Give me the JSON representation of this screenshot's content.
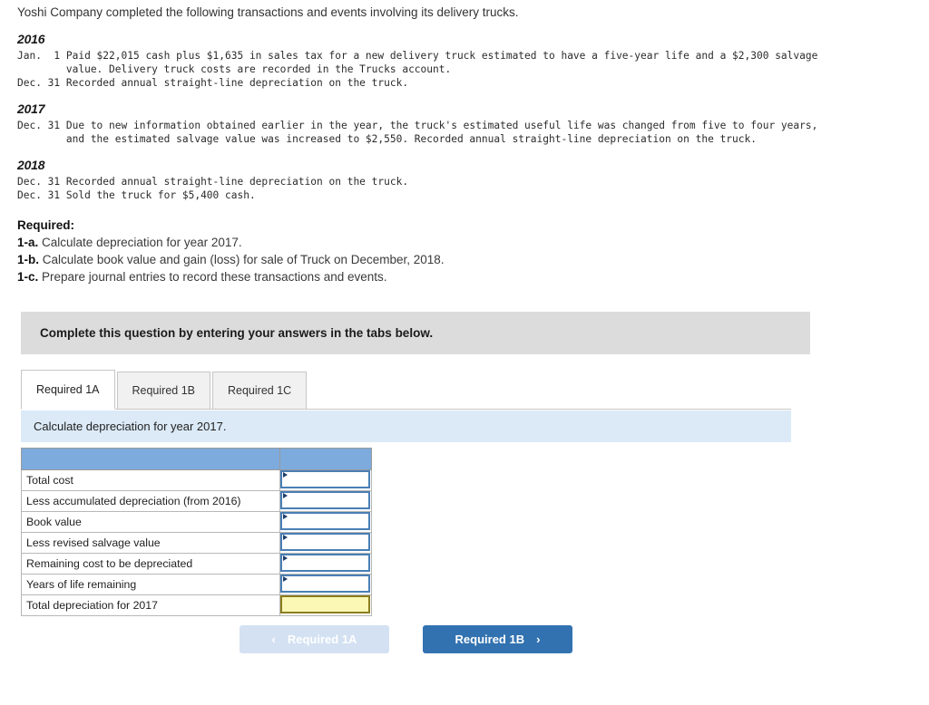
{
  "intro": "Yoshi Company completed the following transactions and events involving its delivery trucks.",
  "years": [
    {
      "label": "2016",
      "entries": "Jan.  1 Paid $22,015 cash plus $1,635 in sales tax for a new delivery truck estimated to have a five-year life and a $2,300 salvage\n        value. Delivery truck costs are recorded in the Trucks account.\nDec. 31 Recorded annual straight-line depreciation on the truck."
    },
    {
      "label": "2017",
      "entries": "Dec. 31 Due to new information obtained earlier in the year, the truck's estimated useful life was changed from five to four years,\n        and the estimated salvage value was increased to $2,550. Recorded annual straight-line depreciation on the truck."
    },
    {
      "label": "2018",
      "entries": "Dec. 31 Recorded annual straight-line depreciation on the truck.\nDec. 31 Sold the truck for $5,400 cash."
    }
  ],
  "required": {
    "heading": "Required:",
    "items": [
      {
        "marker": "1-a.",
        "text": "Calculate depreciation for year 2017."
      },
      {
        "marker": "1-b.",
        "text": "Calculate book value and gain (loss) for sale of Truck on December, 2018."
      },
      {
        "marker": "1-c.",
        "text": "Prepare journal entries to record these transactions and events."
      }
    ]
  },
  "callout": "Complete this question by entering your answers in the tabs below.",
  "tabs": [
    {
      "label": "Required 1A",
      "active": true
    },
    {
      "label": "Required 1B",
      "active": false
    },
    {
      "label": "Required 1C",
      "active": false
    }
  ],
  "sub_instruction": "Calculate depreciation for year 2017.",
  "table": {
    "header": [
      "",
      ""
    ],
    "rows": [
      {
        "label": "Total cost",
        "value": "",
        "type": "input"
      },
      {
        "label": "Less accumulated depreciation (from 2016)",
        "value": "",
        "type": "input"
      },
      {
        "label": "Book value",
        "value": "",
        "type": "input"
      },
      {
        "label": "Less revised salvage value",
        "value": "",
        "type": "input"
      },
      {
        "label": "Remaining cost to be depreciated",
        "value": "",
        "type": "input"
      },
      {
        "label": "Years of life remaining",
        "value": "",
        "type": "input"
      },
      {
        "label": "Total depreciation for 2017",
        "value": "",
        "type": "computed"
      }
    ]
  },
  "nav": {
    "prev_label": "Required 1A",
    "prev_icon": "chevron-left",
    "next_label": "Required 1B",
    "next_icon": "chevron-right"
  },
  "colors": {
    "table_header": "#7dabdd",
    "computed_cell": "#fbf8b5",
    "accent_blue": "#3272b0",
    "subinstruction_bg": "#dceaf7",
    "callout_bg": "#dcdcdc"
  }
}
